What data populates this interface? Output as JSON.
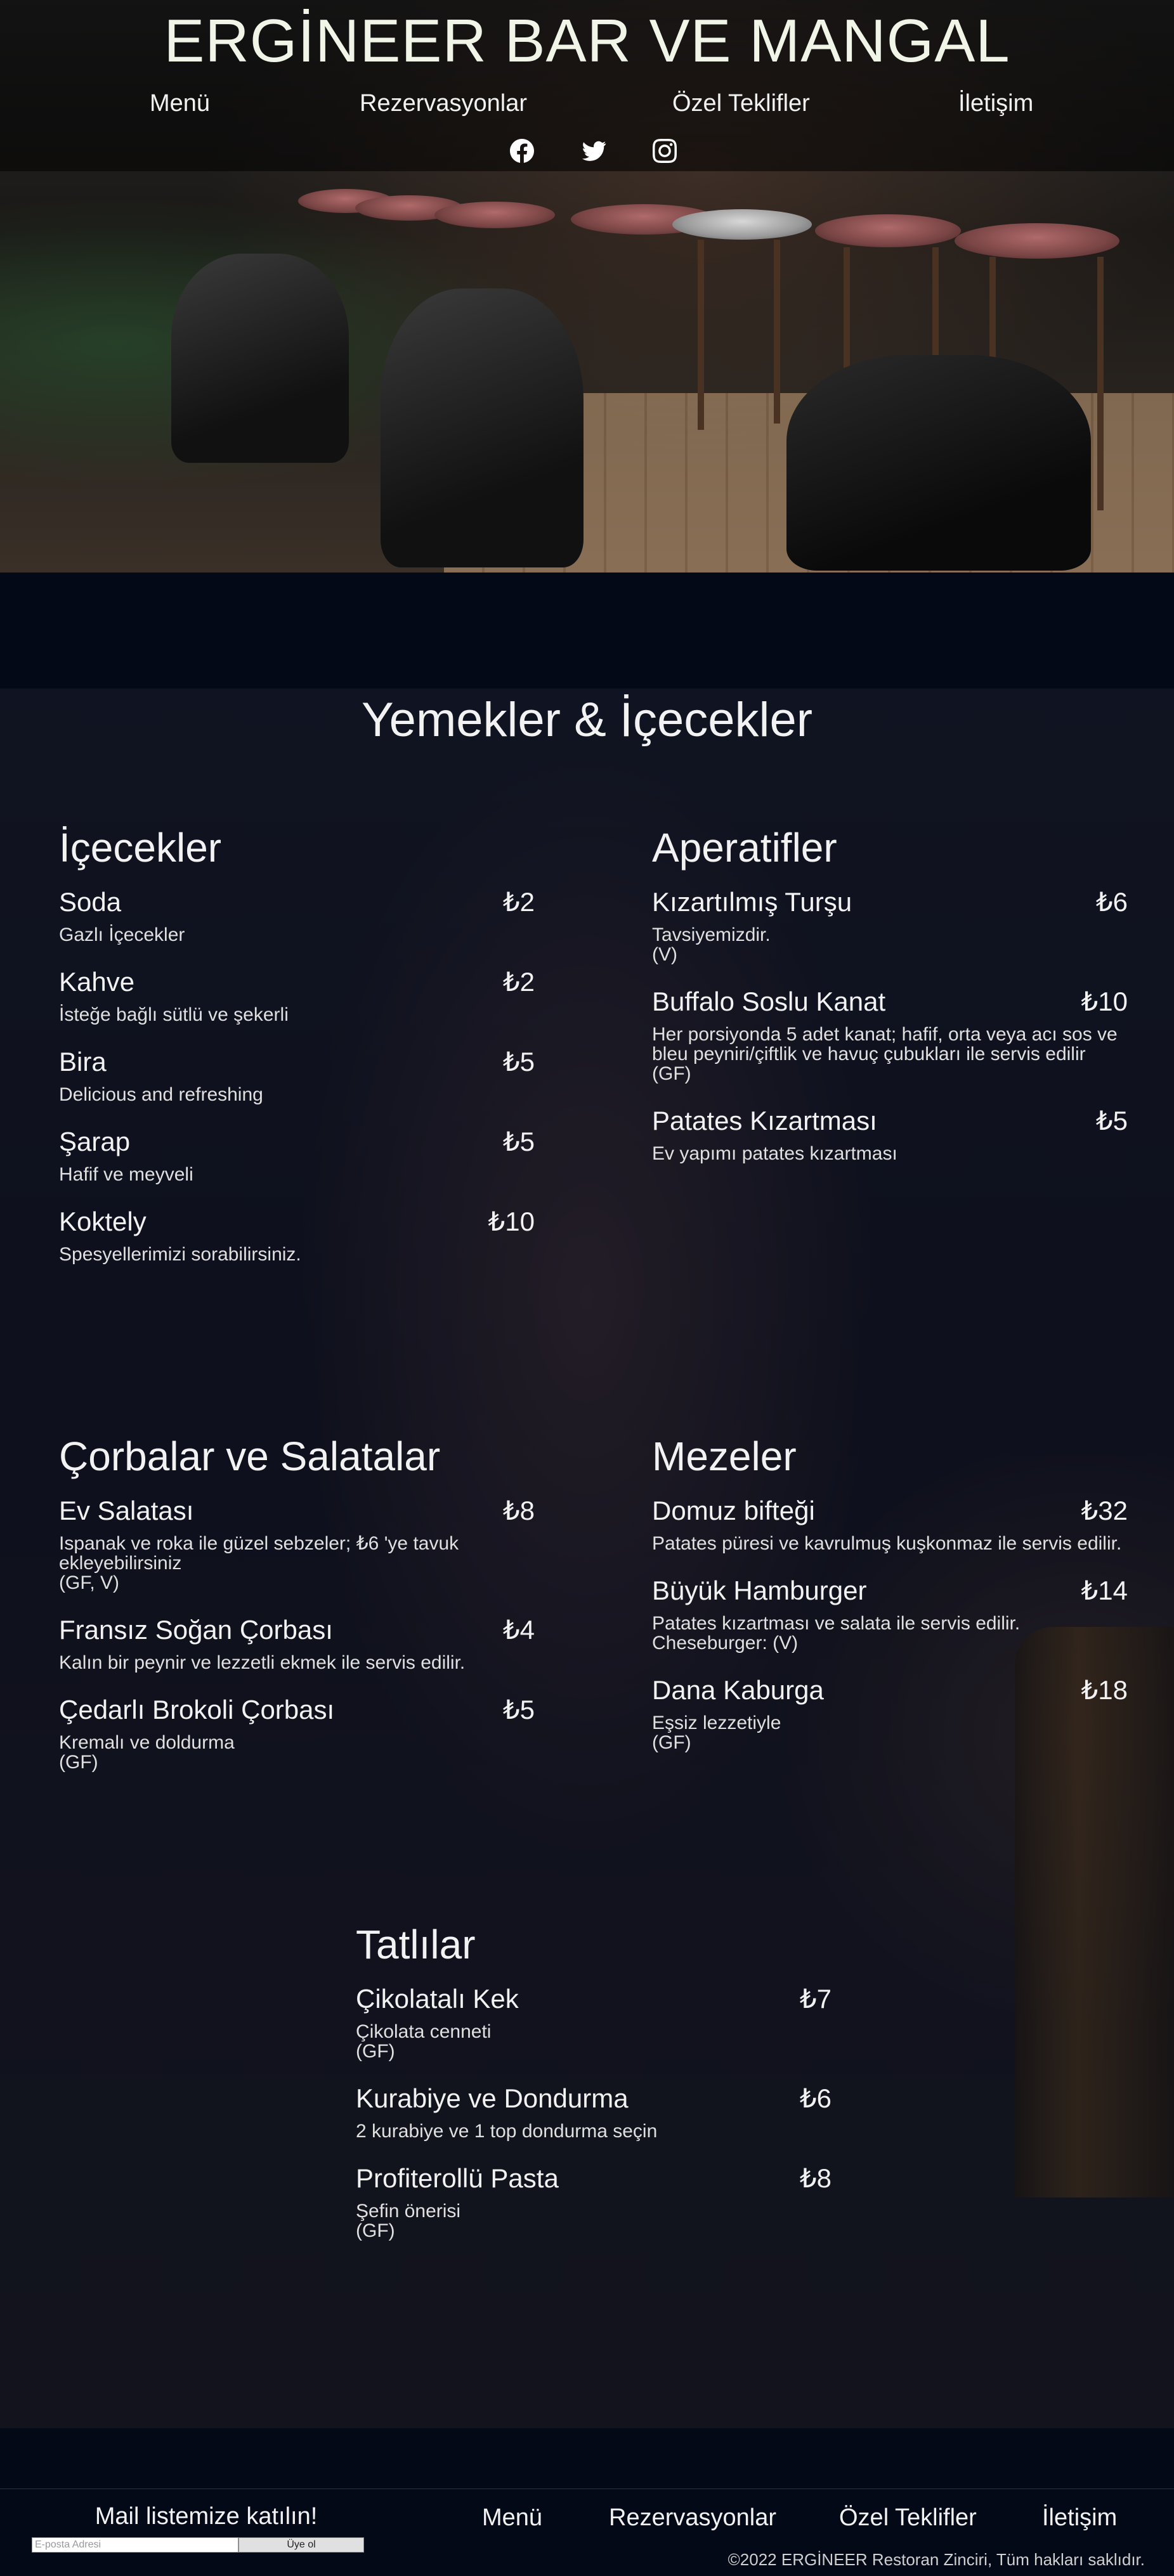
{
  "header": {
    "site_title": "ERGİNEER BAR VE MANGAL",
    "nav": [
      "Menü",
      "Rezervasyonlar",
      "Özel Teklifler",
      "İletişim"
    ],
    "social": [
      "facebook-icon",
      "twitter-icon",
      "instagram-icon"
    ]
  },
  "menu": {
    "title": "Yemekler & İçecekler",
    "categories": [
      {
        "title": "İçecekler",
        "items": [
          {
            "name": "Soda",
            "price": "₺2",
            "desc": "Gazlı İçecekler",
            "tag": ""
          },
          {
            "name": "Kahve",
            "price": "₺2",
            "desc": "İsteğe bağlı sütlü ve şekerli",
            "tag": ""
          },
          {
            "name": "Bira",
            "price": "₺5",
            "desc": "Delicious and refreshing",
            "tag": ""
          },
          {
            "name": "Şarap",
            "price": "₺5",
            "desc": "Hafif ve meyveli",
            "tag": ""
          },
          {
            "name": "Koktely",
            "price": "₺10",
            "desc": "Spesyellerimizi sorabilirsiniz.",
            "tag": ""
          }
        ]
      },
      {
        "title": "Aperatifler",
        "items": [
          {
            "name": "Kızartılmış Turşu",
            "price": "₺6",
            "desc": "Tavsiyemizdir.",
            "tag": "(V)"
          },
          {
            "name": "Buffalo Soslu Kanat",
            "price": "₺10",
            "desc": "Her porsiyonda 5 adet kanat; hafif, orta veya acı sos ve bleu peyniri/çiftlik ve havuç çubukları ile servis edilir",
            "tag": "(GF)"
          },
          {
            "name": "Patates Kızartması",
            "price": "₺5",
            "desc": "Ev yapımı patates kızartması",
            "tag": ""
          }
        ]
      },
      {
        "title": "Çorbalar ve Salatalar",
        "items": [
          {
            "name": "Ev Salatası",
            "price": "₺8",
            "desc": "Ispanak ve roka ile güzel sebzeler; ₺6 'ye tavuk ekleyebilirsiniz",
            "tag": "(GF, V)"
          },
          {
            "name": "Fransız Soğan Çorbası",
            "price": "₺4",
            "desc": "Kalın bir peynir ve lezzetli ekmek ile servis edilir.",
            "tag": ""
          },
          {
            "name": "Çedarlı Brokoli Çorbası",
            "price": "₺5",
            "desc": "Kremalı ve doldurma",
            "tag": "(GF)"
          }
        ]
      },
      {
        "title": "Mezeler",
        "items": [
          {
            "name": "Domuz bifteği",
            "price": "₺32",
            "desc": "Patates püresi ve kavrulmuş kuşkonmaz ile servis edilir.",
            "tag": ""
          },
          {
            "name": "Büyük Hamburger",
            "price": "₺14",
            "desc": "Patates kızartması ve salata ile servis edilir. Cheseburger: (V)",
            "tag": ""
          },
          {
            "name": "Dana Kaburga",
            "price": "₺18",
            "desc": "Eşsiz lezzetiyle",
            "tag": "(GF)"
          }
        ]
      },
      {
        "title": "Tatlılar",
        "items": [
          {
            "name": "Çikolatalı Kek",
            "price": "₺7",
            "desc": "Çikolata cenneti",
            "tag": "(GF)"
          },
          {
            "name": "Kurabiye ve Dondurma",
            "price": "₺6",
            "desc": "2 kurabiye ve 1 top dondurma seçin",
            "tag": ""
          },
          {
            "name": "Profiterollü Pasta",
            "price": "₺8",
            "desc": "Şefin önerisi",
            "tag": "(GF)"
          }
        ]
      }
    ]
  },
  "footer": {
    "mail_title": "Mail listemize katılın!",
    "mail_placeholder": "E-posta Adresi",
    "mail_button": "Üye ol",
    "nav": [
      "Menü",
      "Rezervasyonlar",
      "Özel Teklifler",
      "İletişim"
    ],
    "copyright": "©2022 ERGİNEER Restoran Zinciri, Tüm hakları saklıdır."
  }
}
